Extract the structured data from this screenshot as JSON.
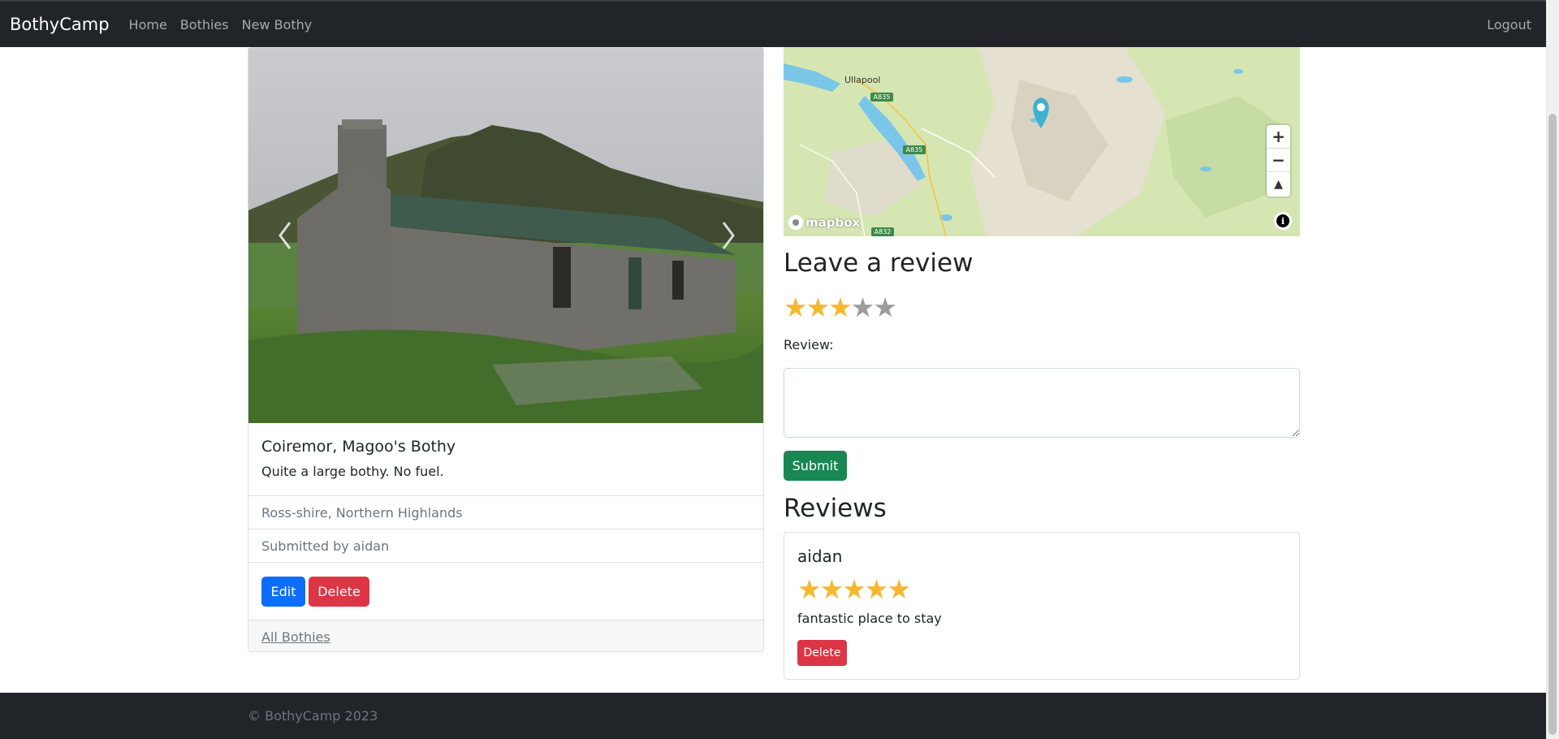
{
  "navbar": {
    "brand": "BothyCamp",
    "links": [
      "Home",
      "Bothies",
      "New Bothy"
    ],
    "logout": "Logout"
  },
  "bothy": {
    "title": "Coiremor, Magoo's Bothy",
    "description": "Quite a large bothy. No fuel.",
    "location": "Ross-shire, Northern Highlands",
    "submitted_by": "Submitted by aidan",
    "edit_label": "Edit",
    "delete_label": "Delete",
    "all_bothies_label": "All Bothies"
  },
  "map": {
    "labels": {
      "town": "Ullapool",
      "road1": "A835",
      "road2": "A835",
      "road3": "A832"
    },
    "zoom_in": "+",
    "zoom_out": "−",
    "compass": "▲",
    "attribution_logo": "mapbox",
    "info": "i"
  },
  "review_form": {
    "heading": "Leave a review",
    "rating": 3,
    "max_rating": 5,
    "review_label": "Review:",
    "review_value": "",
    "submit_label": "Submit"
  },
  "reviews": {
    "heading": "Reviews",
    "items": [
      {
        "author": "aidan",
        "rating": 5,
        "text": "fantastic place to stay",
        "delete_label": "Delete"
      }
    ]
  },
  "footer": {
    "copyright": "© BothyCamp 2023"
  },
  "colors": {
    "navbar_bg": "#212529",
    "star_on": "#f4b831",
    "star_off": "#9c9c9c",
    "primary": "#0d6efd",
    "danger": "#dc3545",
    "success": "#198754"
  }
}
